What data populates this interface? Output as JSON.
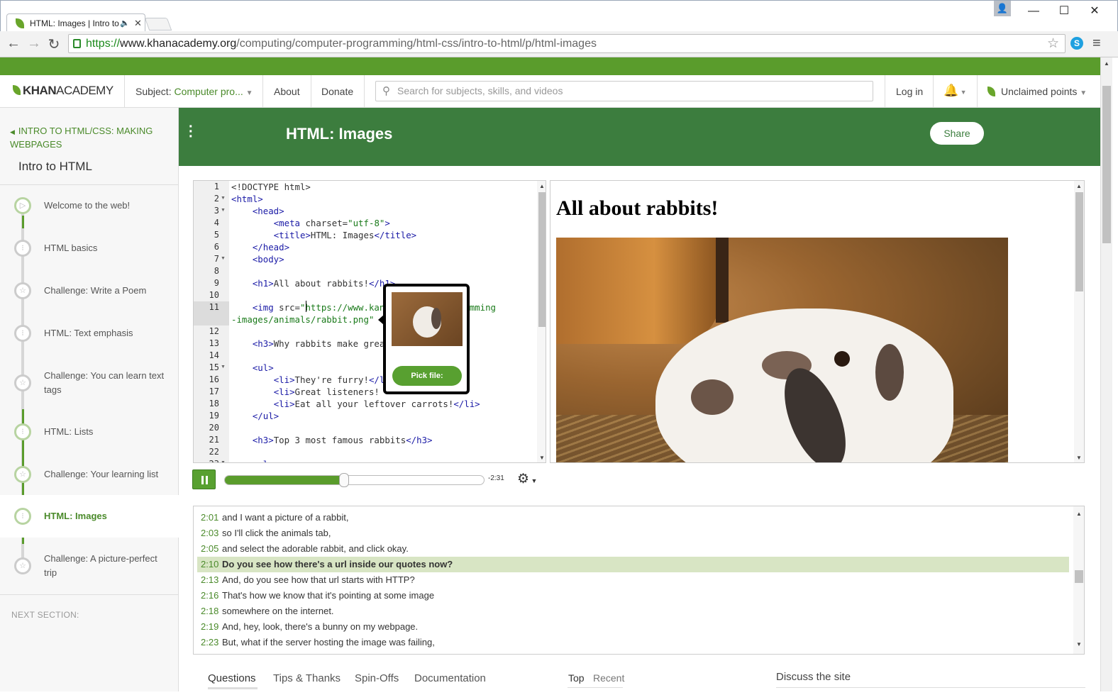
{
  "browser": {
    "tab_title": "HTML: Images | Intro to",
    "url_scheme": "https://",
    "url_host": "www.khanacademy.org",
    "url_path": "/computing/computer-programming/html-css/intro-to-html/p/html-images"
  },
  "header": {
    "logo_khan": "KHAN",
    "logo_academy": "ACADEMY",
    "subject_label": "Subject: ",
    "subject_value": "Computer pro...",
    "about": "About",
    "donate": "Donate",
    "search_placeholder": "Search for subjects, skills, and videos",
    "login": "Log in",
    "points": "Unclaimed points"
  },
  "sidebar": {
    "breadcrumb": "INTRO TO HTML/CSS: MAKING WEBPAGES",
    "section_title": "Intro to HTML",
    "items": [
      {
        "label": "Welcome to the web!"
      },
      {
        "label": "HTML basics"
      },
      {
        "label": "Challenge: Write a Poem"
      },
      {
        "label": "HTML: Text emphasis"
      },
      {
        "label": "Challenge: You can learn text tags"
      },
      {
        "label": "HTML: Lists"
      },
      {
        "label": "Challenge: Your learning list"
      },
      {
        "label": "HTML: Images"
      },
      {
        "label": "Challenge: A picture-perfect trip"
      }
    ],
    "next_section": "NEXT SECTION:"
  },
  "page": {
    "title": "HTML: Images",
    "share": "Share"
  },
  "editor": {
    "line_numbers": [
      "1",
      "2",
      "3",
      "4",
      "5",
      "6",
      "7",
      "8",
      "9",
      "10",
      "11",
      "",
      "12",
      "13",
      "14",
      "15",
      "16",
      "17",
      "18",
      "19",
      "20",
      "21",
      "22",
      "23"
    ],
    "popup_button": "Pick file:"
  },
  "preview": {
    "heading": "All about rabbits!"
  },
  "player": {
    "time_remaining": "-2:31",
    "progress_fraction": 0.46
  },
  "transcript": [
    {
      "time": "2:01",
      "text": "and I want a picture of a rabbit,"
    },
    {
      "time": "2:03",
      "text": "so I'll click the animals tab,"
    },
    {
      "time": "2:05",
      "text": "and select the adorable rabbit, and click okay."
    },
    {
      "time": "2:10",
      "text": "Do you see how there's a url inside our quotes now?"
    },
    {
      "time": "2:13",
      "text": "And, do you see how that url starts with HTTP?"
    },
    {
      "time": "2:16",
      "text": "That's how we know that it's pointing at some image"
    },
    {
      "time": "2:18",
      "text": "somewhere on the internet."
    },
    {
      "time": "2:19",
      "text": "And, hey, look, there's a bunny on my webpage."
    },
    {
      "time": "2:23",
      "text": "But, what if the server hosting the image was failing,"
    }
  ],
  "bottom_tabs": {
    "questions": "Questions",
    "tips": "Tips & Thanks",
    "spinoffs": "Spin-Offs",
    "documentation": "Documentation",
    "sort_top": "Top",
    "sort_recent": "Recent",
    "discuss": "Discuss the site"
  },
  "colors": {
    "brand_green": "#3c7d3e",
    "accent_green": "#5a9c2c"
  }
}
